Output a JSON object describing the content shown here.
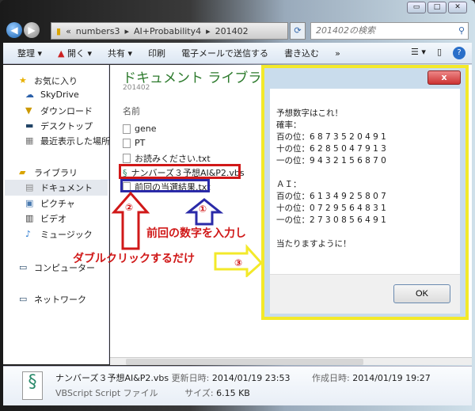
{
  "window": {
    "minimize": "▭",
    "maximize": "□",
    "close": "✕"
  },
  "address": {
    "sep": "«",
    "crumbs": [
      "numbers3",
      "AI+Probability4",
      "201402"
    ],
    "search_placeholder": "201402の検索"
  },
  "toolbar": {
    "organize": "整理 ▾",
    "open": "開く ▾",
    "share": "共有 ▾",
    "print": "印刷",
    "email": "電子メールで送信する",
    "burn": "書き込む",
    "more": "»"
  },
  "sidebar": {
    "favorites": "お気に入り",
    "skydrive": "SkyDrive",
    "downloads": "ダウンロード",
    "desktop": "デスクトップ",
    "recent": "最近表示した場所",
    "libraries": "ライブラリ",
    "documents": "ドキュメント",
    "pictures": "ピクチャ",
    "videos": "ビデオ",
    "music": "ミュージック",
    "computer": "コンピューター",
    "network": "ネットワーク"
  },
  "content": {
    "title": "ドキュメント ライブラリ",
    "subtitle": "201402",
    "col_name": "名前",
    "files": [
      "gene",
      "PT",
      "お読みください.txt",
      "ナンバーズ３予想AI&P2.vbs",
      "前回の当選結果.txt"
    ]
  },
  "dialog": {
    "close": "x",
    "message": "予想数字はこれ！\n確率：\n百の位：6 8 7 3 5 2 0 4 9 1\n十の位：6 2 8 5 0 4 7 9 1 3\n一の位：9 4 3 2 1 5 6 8 7 0\n\nＡＩ：\n百の位：6 1 3 4 9 2 5 8 0 7\n十の位：0 7 2 9 5 6 4 8 3 1\n一の位：2 7 3 0 8 5 6 4 9 1\n\n当たりますように！",
    "ok": "OK"
  },
  "details": {
    "name": "ナンバーズ３予想AI&P2.vbs",
    "modified_label": "更新日時:",
    "modified": "2014/01/19 23:53",
    "created_label": "作成日時:",
    "created": "2014/01/19 19:27",
    "type": "VBScript Script ファイル",
    "size_label": "サイズ:",
    "size": "6.15 KB"
  },
  "annotations": {
    "step1": "①",
    "step2": "②",
    "step3": "③",
    "text1": "前回の数字を入力し",
    "text2": "ダブルクリックするだけ"
  },
  "colors": {
    "red": "#d01818",
    "blue": "#2a2aa8",
    "yellow": "#f3e92a",
    "green_title": "#2c7a2c"
  }
}
